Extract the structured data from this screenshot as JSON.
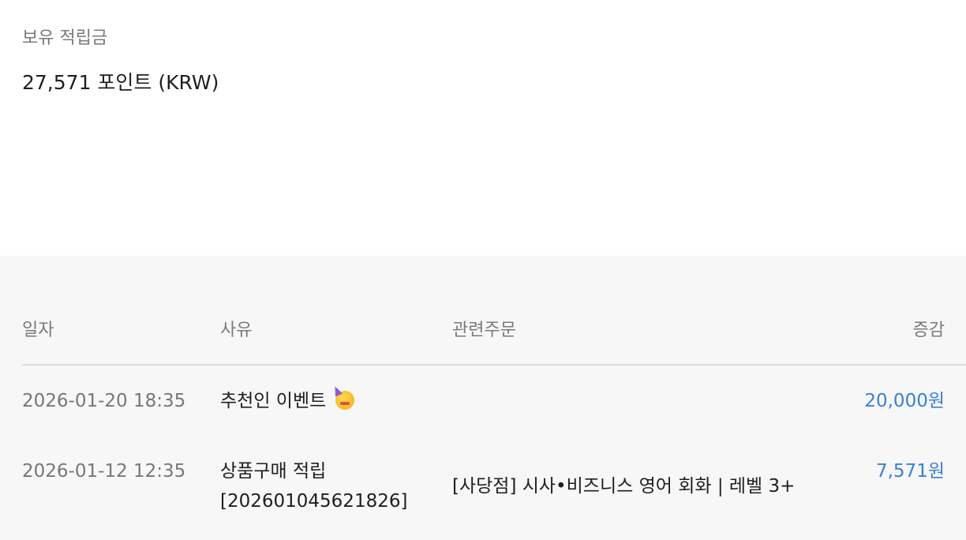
{
  "summary": {
    "label": "보유 적립금",
    "balance": "27,571 포인트 (KRW)"
  },
  "table": {
    "headers": {
      "date": "일자",
      "reason": "사유",
      "order": "관련주문",
      "amount": "증감"
    },
    "rows": [
      {
        "date": "2026-01-20 18:35",
        "reason": "추천인 이벤트",
        "reason_icon": "party-face-icon",
        "order": "",
        "amount": "20,000원"
      },
      {
        "date": "2026-01-12 12:35",
        "reason_line1": "상품구매 적립",
        "reason_line2": "[202601045621826]",
        "order": "[사당점] 시사•비즈니스 영어 회화 | 레벨 3+",
        "amount": "7,571원"
      }
    ]
  },
  "colors": {
    "amount_positive": "#3b7fd6",
    "muted_text": "#7a7a7a",
    "table_background": "#f7f7f7"
  }
}
